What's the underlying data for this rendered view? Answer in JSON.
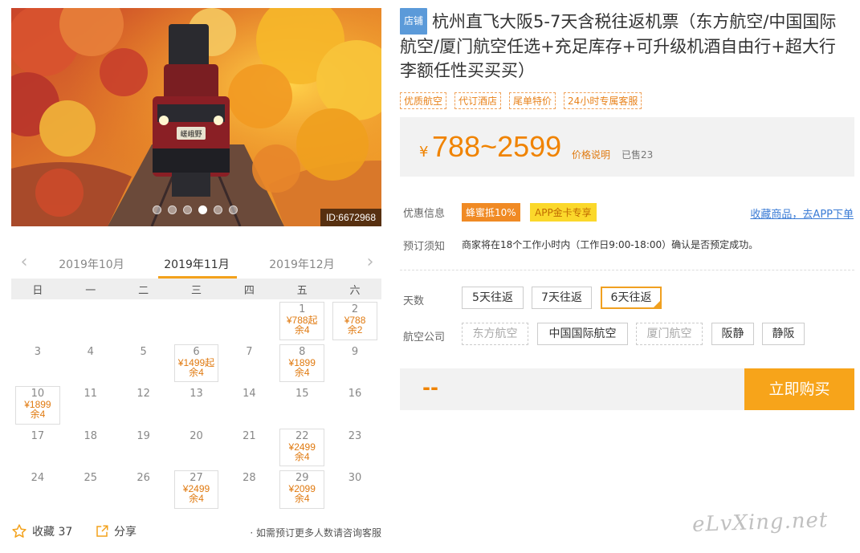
{
  "gallery": {
    "photo_id": "ID:6672968",
    "dot_count": 6,
    "active_dot": 3,
    "train_board_text": "嵯峨野"
  },
  "calendar": {
    "months": [
      "2019年10月",
      "2019年11月",
      "2019年12月"
    ],
    "active_month": 1,
    "weekdays": [
      "日",
      "一",
      "二",
      "三",
      "四",
      "五",
      "六"
    ],
    "first_weekday": 5,
    "days_in_month": 30,
    "available": {
      "1": {
        "price": "¥788起",
        "stock": "余4"
      },
      "2": {
        "price": "¥788",
        "stock": "余2"
      },
      "6": {
        "price": "¥1499起",
        "stock": "余4"
      },
      "8": {
        "price": "¥1899",
        "stock": "余4"
      },
      "10": {
        "price": "¥1899",
        "stock": "余4"
      },
      "22": {
        "price": "¥2499",
        "stock": "余4"
      },
      "27": {
        "price": "¥2499",
        "stock": "余4"
      },
      "29": {
        "price": "¥2099",
        "stock": "余4"
      }
    }
  },
  "footer": {
    "favorite_label": "收藏 37",
    "share_label": "分享",
    "consult_text": "· 如需预订更多人数请咨询客服"
  },
  "product": {
    "shop_tag": "店铺",
    "title": "杭州直飞大阪5-7天含税往返机票（东方航空/中国国际航空/厦门航空任选+充足库存+可升级机酒自由行+超大行李额任性买买买）",
    "tags": [
      "优质航空",
      "代订酒店",
      "尾单特价",
      "24小时专属客服"
    ]
  },
  "price": {
    "currency": "¥",
    "range": "788~2599",
    "note_link": "价格说明",
    "sold": "已售23"
  },
  "promo": {
    "label": "优惠信息",
    "discount_badge": "蜂蜜抵10%",
    "app_badge": "APP金卡专享",
    "app_link": "收藏商品，去APP下单"
  },
  "booking": {
    "label": "预订须知",
    "notice": "商家将在18个工作小时内（工作日9:00-18:00）确认是否预定成功。"
  },
  "options": {
    "days_label": "天数",
    "days": [
      {
        "label": "5天往返",
        "state": "normal"
      },
      {
        "label": "7天往返",
        "state": "normal"
      },
      {
        "label": "6天往返",
        "state": "selected"
      }
    ],
    "airline_label": "航空公司",
    "airlines": [
      {
        "label": "东方航空",
        "state": "disabled"
      },
      {
        "label": "中国国际航空",
        "state": "normal"
      },
      {
        "label": "厦门航空",
        "state": "disabled"
      },
      {
        "label": "阪静",
        "state": "normal"
      },
      {
        "label": "静阪",
        "state": "normal"
      }
    ]
  },
  "buy": {
    "total": "--",
    "button_label": "立即购买"
  },
  "watermark": "eLvXing.net",
  "colors": {
    "accent": "#f08300",
    "button": "#f7a41a",
    "shop_tag": "#5b9ad9",
    "link": "#3a7bd5"
  }
}
